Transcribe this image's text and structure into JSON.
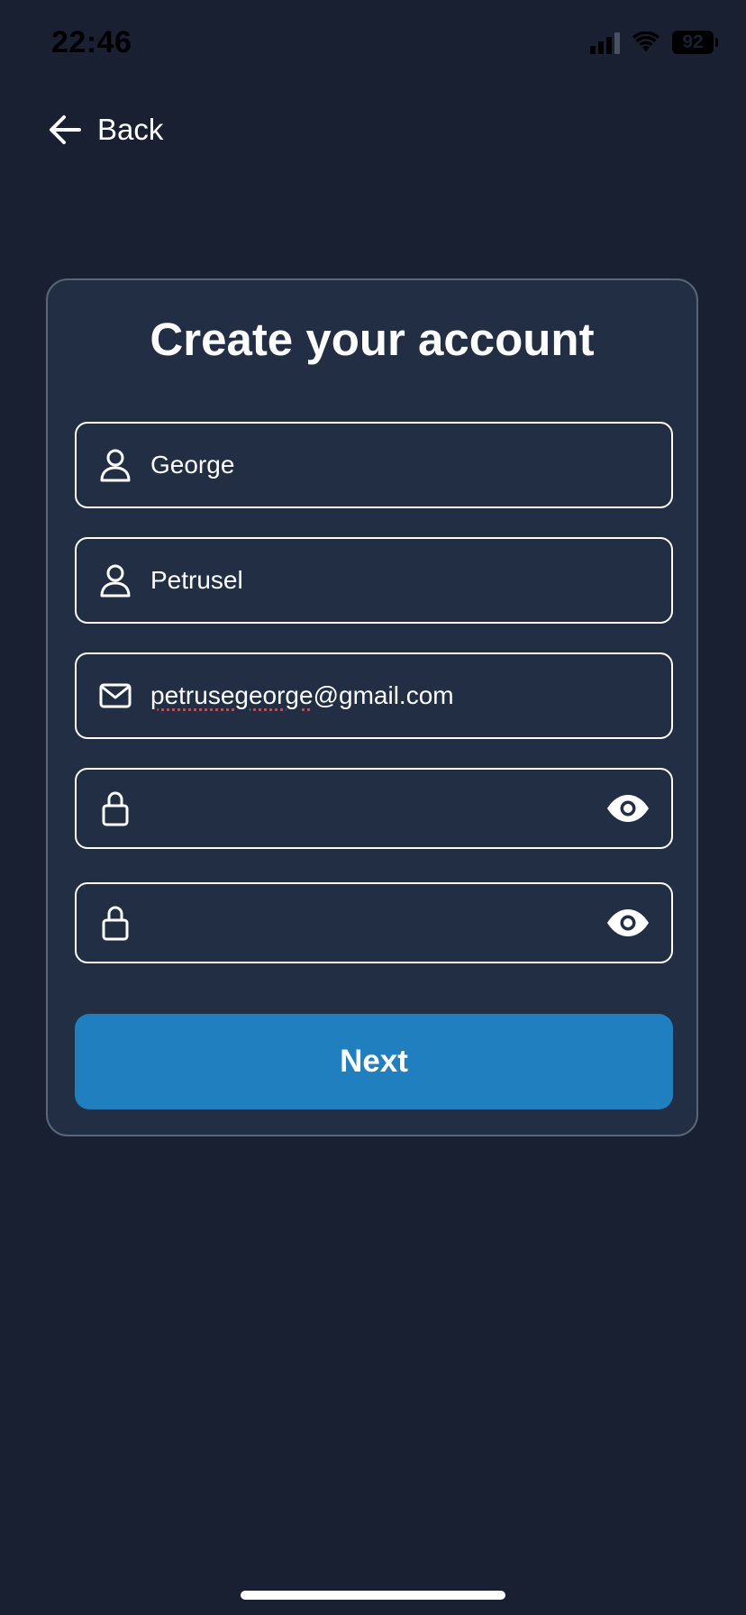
{
  "status_bar": {
    "time": "22:46",
    "battery": "92",
    "icons": [
      "signal-icon",
      "wifi-icon",
      "battery-icon"
    ]
  },
  "nav": {
    "back_label": "Back",
    "back_icon": "arrow-left-icon"
  },
  "form": {
    "title": "Create your account",
    "fields": [
      {
        "icon": "person-icon",
        "value": "George"
      },
      {
        "icon": "person-icon",
        "value": "Petrusel"
      },
      {
        "icon": "mail-icon",
        "value_misspelled": "petrusegeorge",
        "value_rest": "@gmail.com"
      },
      {
        "icon": "lock-icon",
        "value": "",
        "toggle_icon": "eye-icon"
      },
      {
        "icon": "lock-icon",
        "value": "",
        "toggle_icon": "eye-icon"
      }
    ],
    "next_label": "Next"
  },
  "colors": {
    "background": "#182032",
    "card": "#212e44",
    "card_border": "#5a6577",
    "field_border": "#ffffff",
    "primary_button": "#1f7fbf",
    "text": "#ffffff"
  }
}
